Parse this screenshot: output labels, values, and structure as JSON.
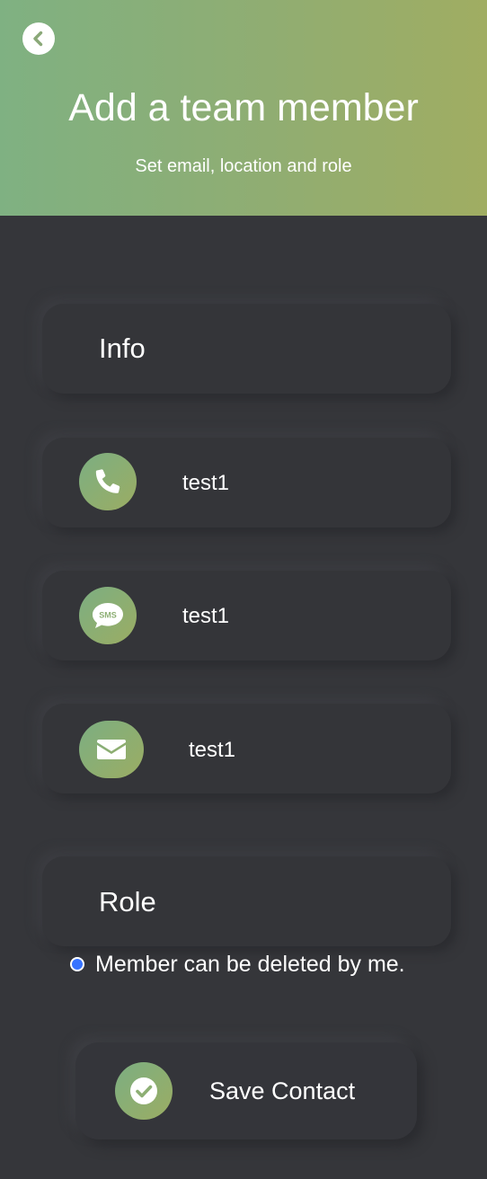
{
  "header": {
    "back_icon": "chevron-left-icon",
    "title": "Add a team member",
    "subtitle": "Set email, location and role"
  },
  "info_section": {
    "heading": "Info",
    "fields": [
      {
        "icon": "phone-icon",
        "value": "test1"
      },
      {
        "icon": "sms-icon",
        "icon_text": "SMS",
        "value": "test1"
      },
      {
        "icon": "envelope-icon",
        "value": "test1"
      }
    ]
  },
  "role_section": {
    "heading": "Role",
    "option_label": "Member can be deleted by me.",
    "option_selected": true
  },
  "save_button": {
    "icon": "check-circle-icon",
    "label": "Save Contact"
  },
  "colors": {
    "background": "#35363a",
    "header_gradient_start": "#7fb182",
    "header_gradient_end": "#a0ad62",
    "radio_accent": "#3773ff"
  }
}
